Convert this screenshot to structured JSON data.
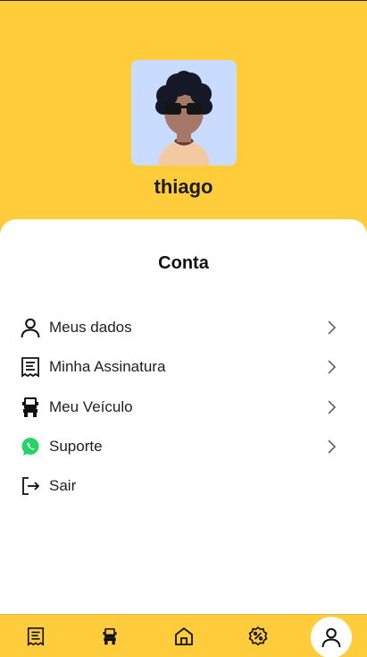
{
  "profile": {
    "username": "thiago"
  },
  "account": {
    "title": "Conta",
    "items": [
      {
        "label": "Meus dados",
        "icon": "user-icon",
        "has_chevron": true
      },
      {
        "label": "Minha Assinatura",
        "icon": "receipt-icon",
        "has_chevron": true
      },
      {
        "label": "Meu Veículo",
        "icon": "truck-icon",
        "has_chevron": true
      },
      {
        "label": "Suporte",
        "icon": "whatsapp-icon",
        "has_chevron": true
      },
      {
        "label": "Sair",
        "icon": "logout-icon",
        "has_chevron": false
      }
    ]
  },
  "bottom_nav": {
    "items": [
      {
        "icon": "receipt-icon"
      },
      {
        "icon": "truck-icon"
      },
      {
        "icon": "home-icon"
      },
      {
        "icon": "discount-badge-icon"
      },
      {
        "icon": "user-icon",
        "active": true
      }
    ]
  },
  "colors": {
    "brand_yellow": "#ffcd3c",
    "whatsapp_green": "#25d366",
    "avatar_bg": "#c9dbff"
  }
}
